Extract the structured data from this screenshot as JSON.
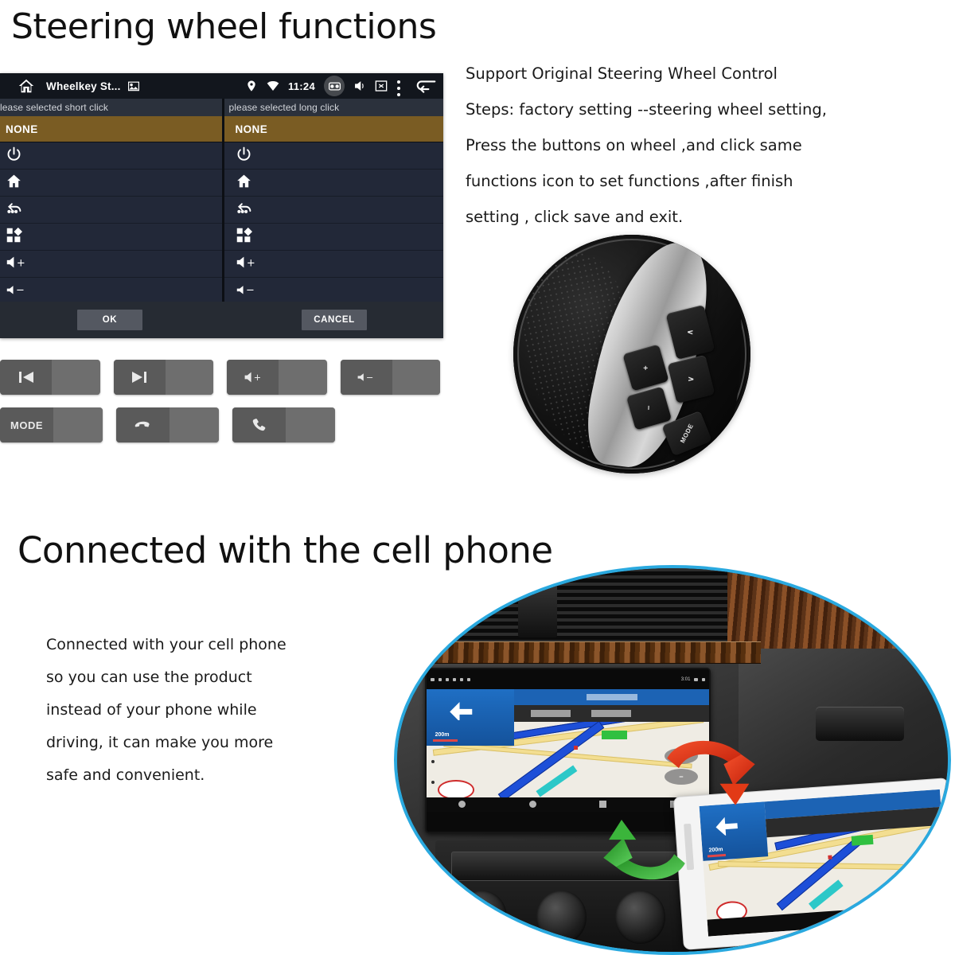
{
  "section1": {
    "heading": "Steering wheel functions",
    "android_panel": {
      "title": "Wheelkey St...",
      "home_icon": "home-icon",
      "picture_icon": "picture-icon",
      "status": {
        "location_icon": "location-pin-icon",
        "wifi_icon": "wifi-icon",
        "clock": "11:24",
        "camera_icon": "camera-icon",
        "volume_icon": "speaker-icon",
        "sdcard_icon": "sdcard-off-icon",
        "overflow_icon": "overflow-menu-icon",
        "back_icon": "back-arrow-icon"
      },
      "columns": [
        {
          "header": "lease selected short click",
          "selected": "NONE",
          "items": [
            {
              "icon": "power-icon",
              "label": ""
            },
            {
              "icon": "home-icon",
              "label": ""
            },
            {
              "icon": "back-icon",
              "label": ""
            },
            {
              "icon": "apps-grid-icon",
              "label": ""
            },
            {
              "icon": "volume-up-icon",
              "label": ""
            },
            {
              "icon": "volume-down-icon",
              "label": ""
            }
          ]
        },
        {
          "header": "please selected long click",
          "selected": "NONE",
          "items": [
            {
              "icon": "power-icon",
              "label": ""
            },
            {
              "icon": "home-icon",
              "label": ""
            },
            {
              "icon": "back-icon",
              "label": ""
            },
            {
              "icon": "apps-grid-icon",
              "label": ""
            },
            {
              "icon": "volume-up-icon",
              "label": ""
            },
            {
              "icon": "volume-down-icon",
              "label": ""
            }
          ]
        }
      ],
      "ok_label": "OK",
      "cancel_label": "CANCEL",
      "colors": {
        "selected_row": "#7a5c23",
        "list_row": "#222838",
        "titlebar": "#12161d"
      }
    },
    "function_buttons": [
      {
        "icon": "prev-track-icon",
        "label": ""
      },
      {
        "icon": "next-track-icon",
        "label": ""
      },
      {
        "icon": "volume-up-icon",
        "label": ""
      },
      {
        "icon": "volume-down-icon",
        "label": ""
      },
      {
        "icon": "mode-icon",
        "label": "MODE"
      },
      {
        "icon": "hang-up-icon",
        "label": ""
      },
      {
        "icon": "call-icon",
        "label": ""
      }
    ],
    "instructions": [
      "Support Original Steering Wheel Control",
      "Steps: factory setting --steering wheel setting,",
      "Press the buttons on wheel ,and click same",
      "functions icon to set functions ,after finish",
      "setting , click save and exit."
    ],
    "steering_wheel_photo": {
      "name": "steering-wheel-photo",
      "keys": [
        {
          "label": "+",
          "name": "wheel-volume-up-key"
        },
        {
          "label": "−",
          "name": "wheel-volume-down-key"
        },
        {
          "label": "∧",
          "name": "wheel-up-key"
        },
        {
          "label": "∨",
          "name": "wheel-down-key"
        },
        {
          "label": "MODE",
          "name": "wheel-mode-key"
        }
      ]
    }
  },
  "section2": {
    "heading": "Connected with the cell phone",
    "body": [
      "Connected with your cell phone",
      " so you can use the product",
      "instead of your phone while",
      "driving, it can make you more",
      "safe and convenient."
    ],
    "dashboard_photo": {
      "name": "car-dashboard-photo",
      "border_color": "#2aa9df",
      "head_unit": {
        "name": "car-head-unit-screen",
        "nav_distance": "200m",
        "time": "3:01"
      },
      "phone": {
        "name": "smartphone-mirroring-screen"
      },
      "arrows": [
        {
          "name": "mirror-to-phone-arrow",
          "color": "#e23a16"
        },
        {
          "name": "mirror-to-head-unit-arrow",
          "color": "#3bb53b"
        }
      ]
    }
  }
}
